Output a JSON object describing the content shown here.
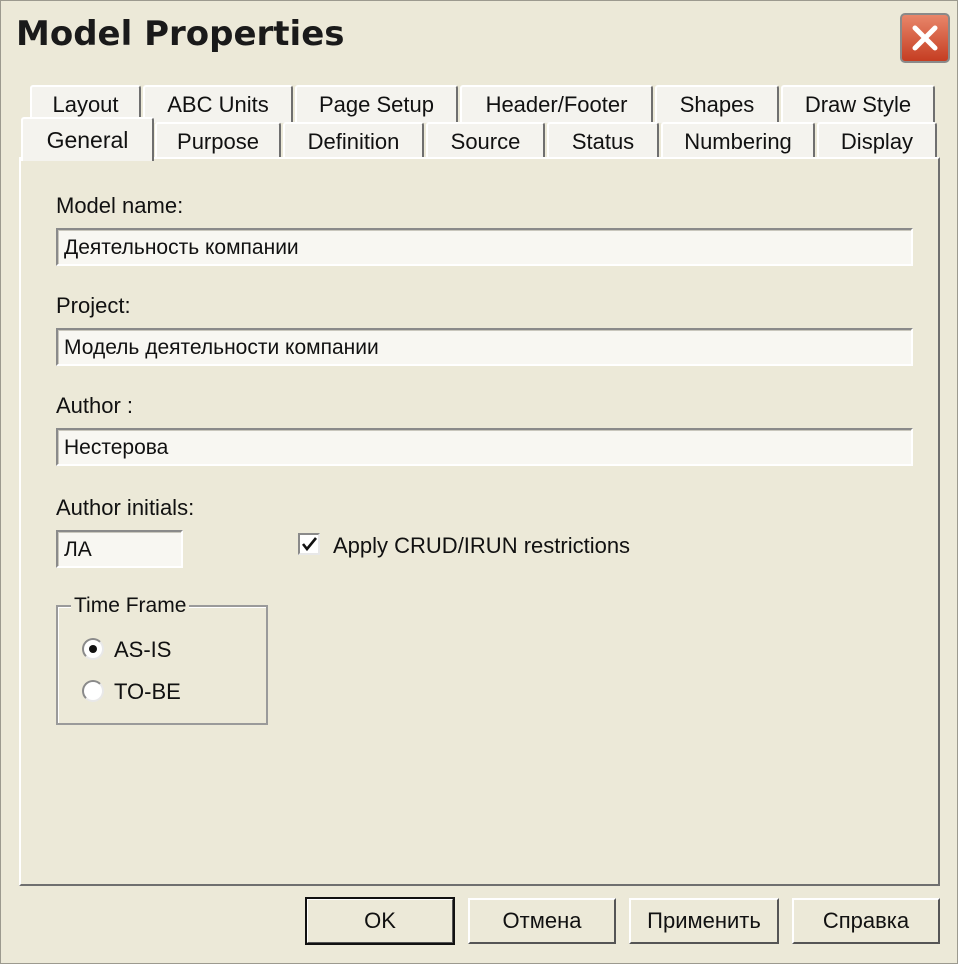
{
  "window": {
    "title": "Model Properties",
    "close_icon": "close-icon"
  },
  "tabs": {
    "row_back": [
      "Layout",
      "ABC Units",
      "Page Setup",
      "Header/Footer",
      "Shapes",
      "Draw Style"
    ],
    "row_front": [
      "General",
      "Purpose",
      "Definition",
      "Source",
      "Status",
      "Numbering",
      "Display"
    ],
    "active": "General"
  },
  "form": {
    "model_name": {
      "label": "Model name:",
      "value": "Деятельность компании"
    },
    "project": {
      "label": "Project:",
      "value": "Модель деятельности компании"
    },
    "author": {
      "label": "Author :",
      "value": "Нестерова"
    },
    "author_initials": {
      "label": "Author initials:",
      "value": "ЛА"
    },
    "crud": {
      "label": "Apply CRUD/IRUN restrictions",
      "checked": true
    },
    "time_frame": {
      "title": "Time Frame",
      "options": [
        "AS-IS",
        "TO-BE"
      ],
      "selected": "AS-IS"
    }
  },
  "buttons": {
    "ok": "OK",
    "cancel": "Отмена",
    "apply": "Применить",
    "help": "Справка"
  },
  "colors": {
    "face": "#ece9d8",
    "close": "#c53d22"
  }
}
